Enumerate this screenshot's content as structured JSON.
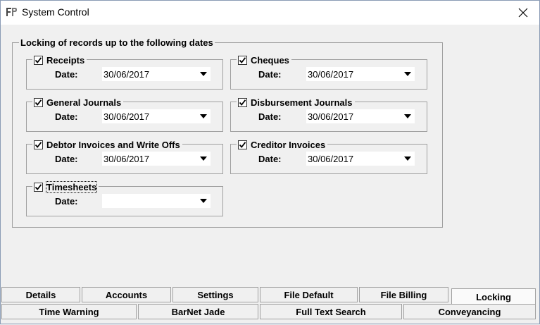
{
  "window": {
    "title": "System Control"
  },
  "group": {
    "label": "Locking of records up to the following dates"
  },
  "date_label": "Date:",
  "locks": [
    {
      "title": "Receipts",
      "checked": true,
      "date": "30/06/2017"
    },
    {
      "title": "Cheques",
      "checked": true,
      "date": "30/06/2017"
    },
    {
      "title": "General Journals",
      "checked": true,
      "date": "30/06/2017"
    },
    {
      "title": "Disbursement Journals",
      "checked": true,
      "date": "30/06/2017"
    },
    {
      "title": "Debtor Invoices and Write Offs",
      "checked": true,
      "date": "30/06/2017"
    },
    {
      "title": "Creditor Invoices",
      "checked": true,
      "date": "30/06/2017"
    },
    {
      "title": "Timesheets",
      "checked": true,
      "date": ""
    }
  ],
  "tabs_row1": [
    "Details",
    "Accounts",
    "Settings",
    "File Default",
    "File Billing",
    "Locking"
  ],
  "tabs_row2": [
    "Time Warning",
    "BarNet Jade",
    "Full Text Search",
    "Conveyancing"
  ],
  "active_tab": "Locking",
  "icons": {
    "app": "app-logo-icon",
    "close": "close-icon",
    "check": "checkmark-icon",
    "dropdown": "chevron-down-icon"
  }
}
